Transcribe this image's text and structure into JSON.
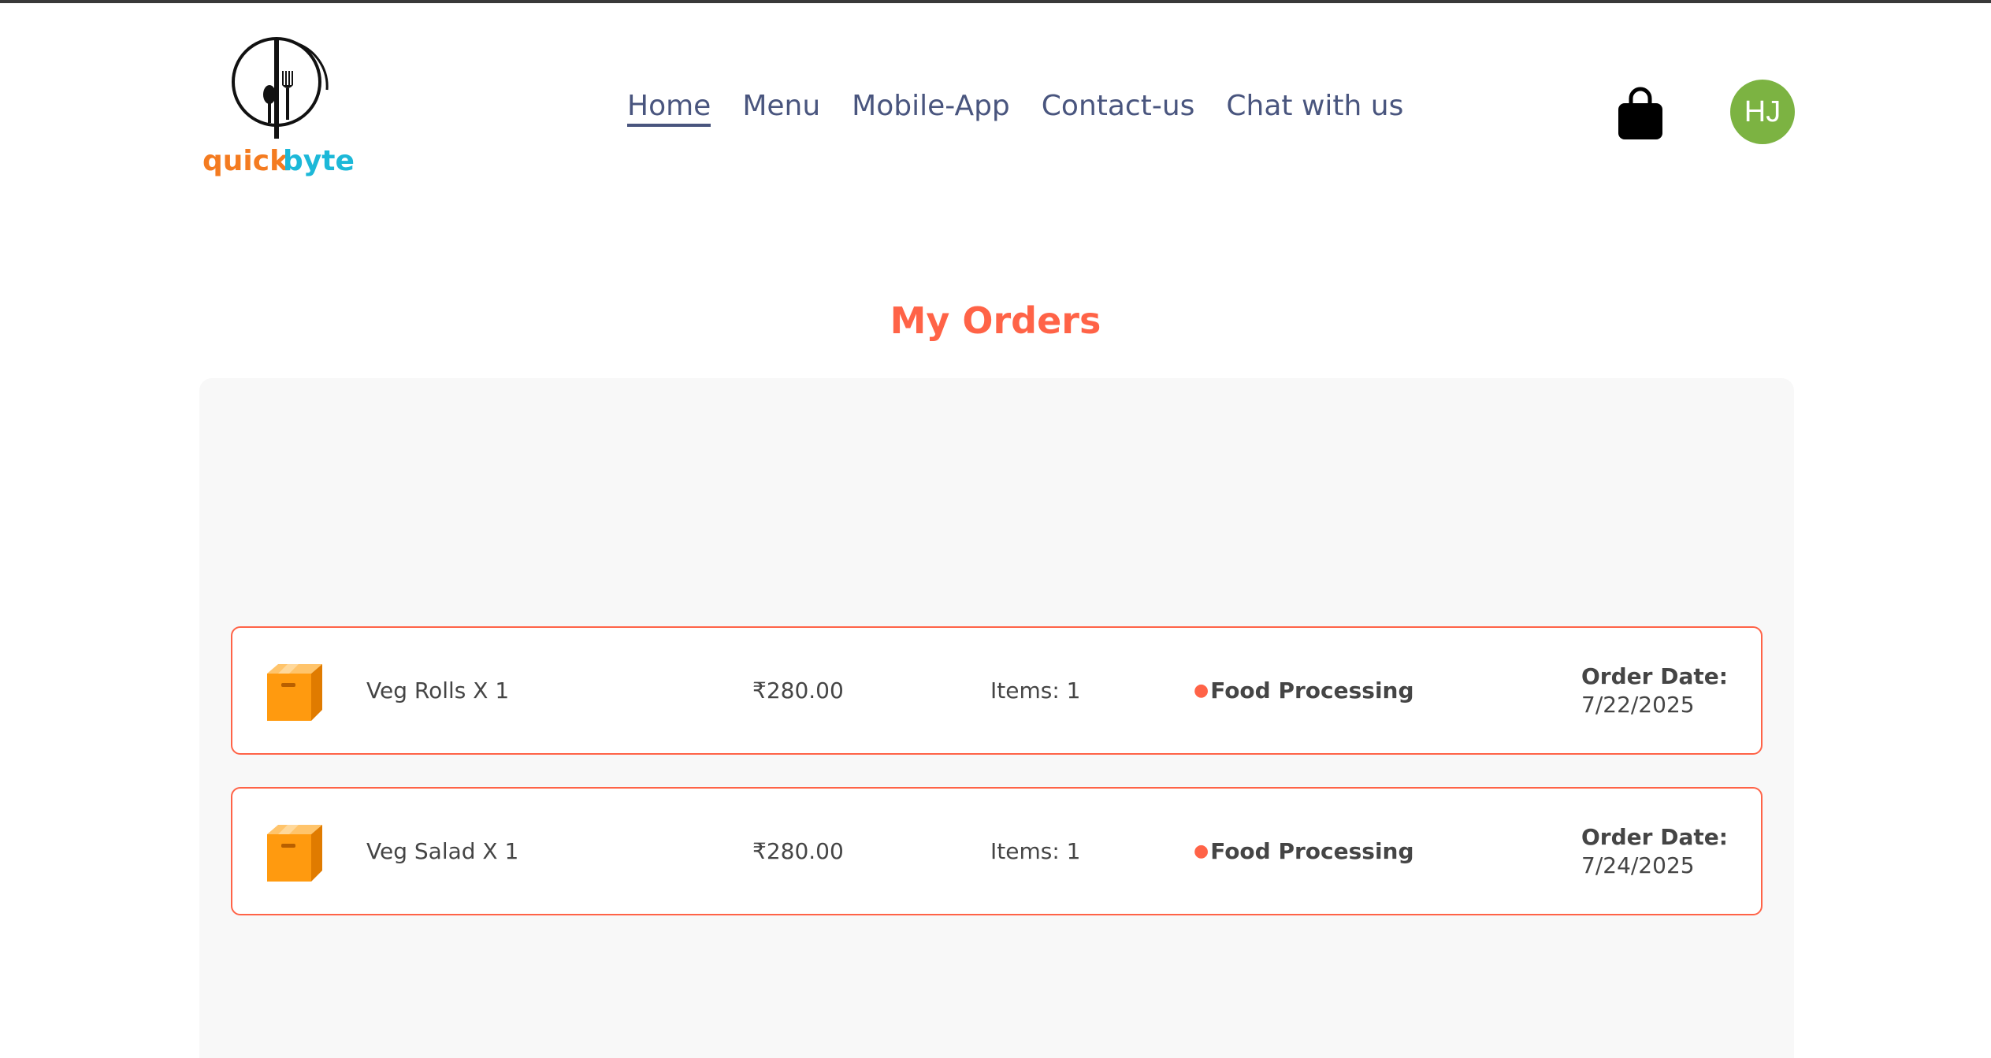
{
  "brand": {
    "logo_word1": "quick",
    "logo_word2": "byte",
    "color_orange": "#f47b20",
    "color_cyan": "#1cb8d8"
  },
  "nav": {
    "items": [
      {
        "label": "Home",
        "active": true
      },
      {
        "label": "Menu",
        "active": false
      },
      {
        "label": "Mobile-App",
        "active": false
      },
      {
        "label": "Contact-us",
        "active": false
      },
      {
        "label": "Chat with us",
        "active": false
      }
    ],
    "cart_icon": "shopping-bag-icon",
    "avatar_initials": "HJ",
    "avatar_color": "#7cb342"
  },
  "page": {
    "title": "My Orders",
    "accent_color": "#ff6347"
  },
  "orders": [
    {
      "icon": "parcel-box-icon",
      "items_text": "Veg Rolls X 1",
      "amount": "₹280.00",
      "count_text": "Items: 1",
      "status_dot": "●",
      "status": "Food Processing",
      "date_label": "Order Date:",
      "date": "7/22/2025"
    },
    {
      "icon": "parcel-box-icon",
      "items_text": "Veg Salad X 1",
      "amount": "₹280.00",
      "count_text": "Items: 1",
      "status_dot": "●",
      "status": "Food Processing",
      "date_label": "Order Date:",
      "date": "7/24/2025"
    }
  ]
}
